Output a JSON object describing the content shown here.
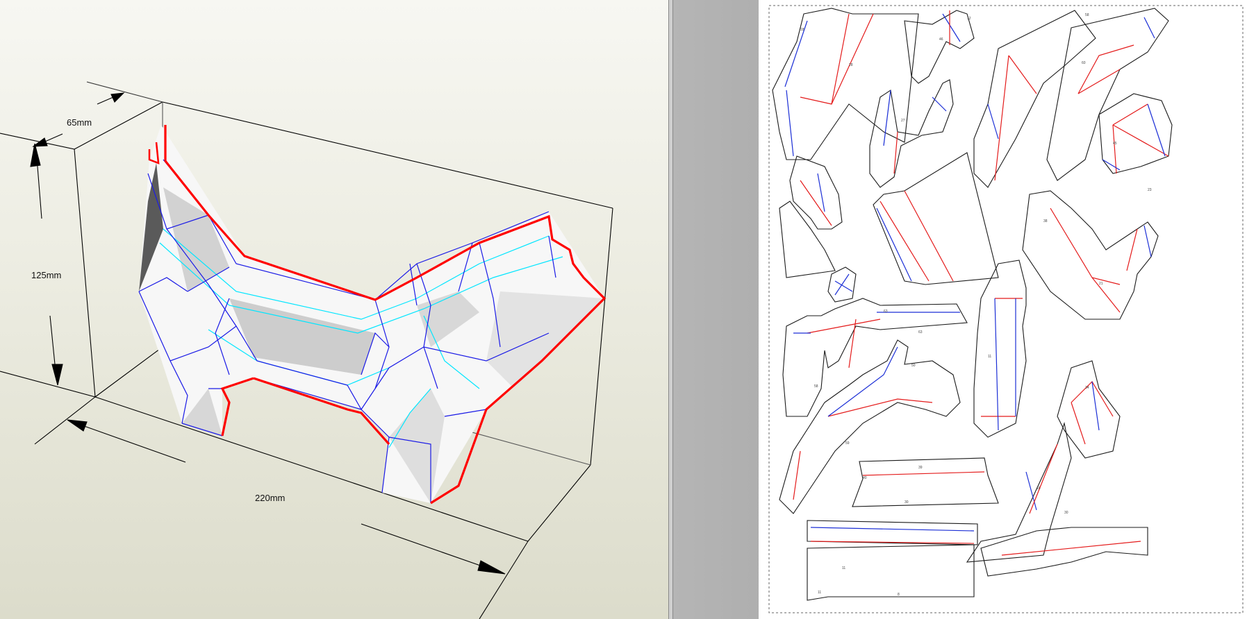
{
  "view3d": {
    "dimensions": {
      "width": "220mm",
      "depth": "65mm",
      "height": "125mm"
    },
    "colors": {
      "cut_edge": "#ff0000",
      "fold_edge": "#1a1ae6",
      "crease_edge": "#00e6ff",
      "bounding_box": "#000000"
    }
  },
  "sheet": {
    "page": "unfolded-pattern",
    "colors": {
      "cut_line": "#1a1a1a",
      "mountain_fold": "#e41b1b",
      "valley_fold": "#1c2fd6",
      "page_border": "#666666"
    }
  }
}
